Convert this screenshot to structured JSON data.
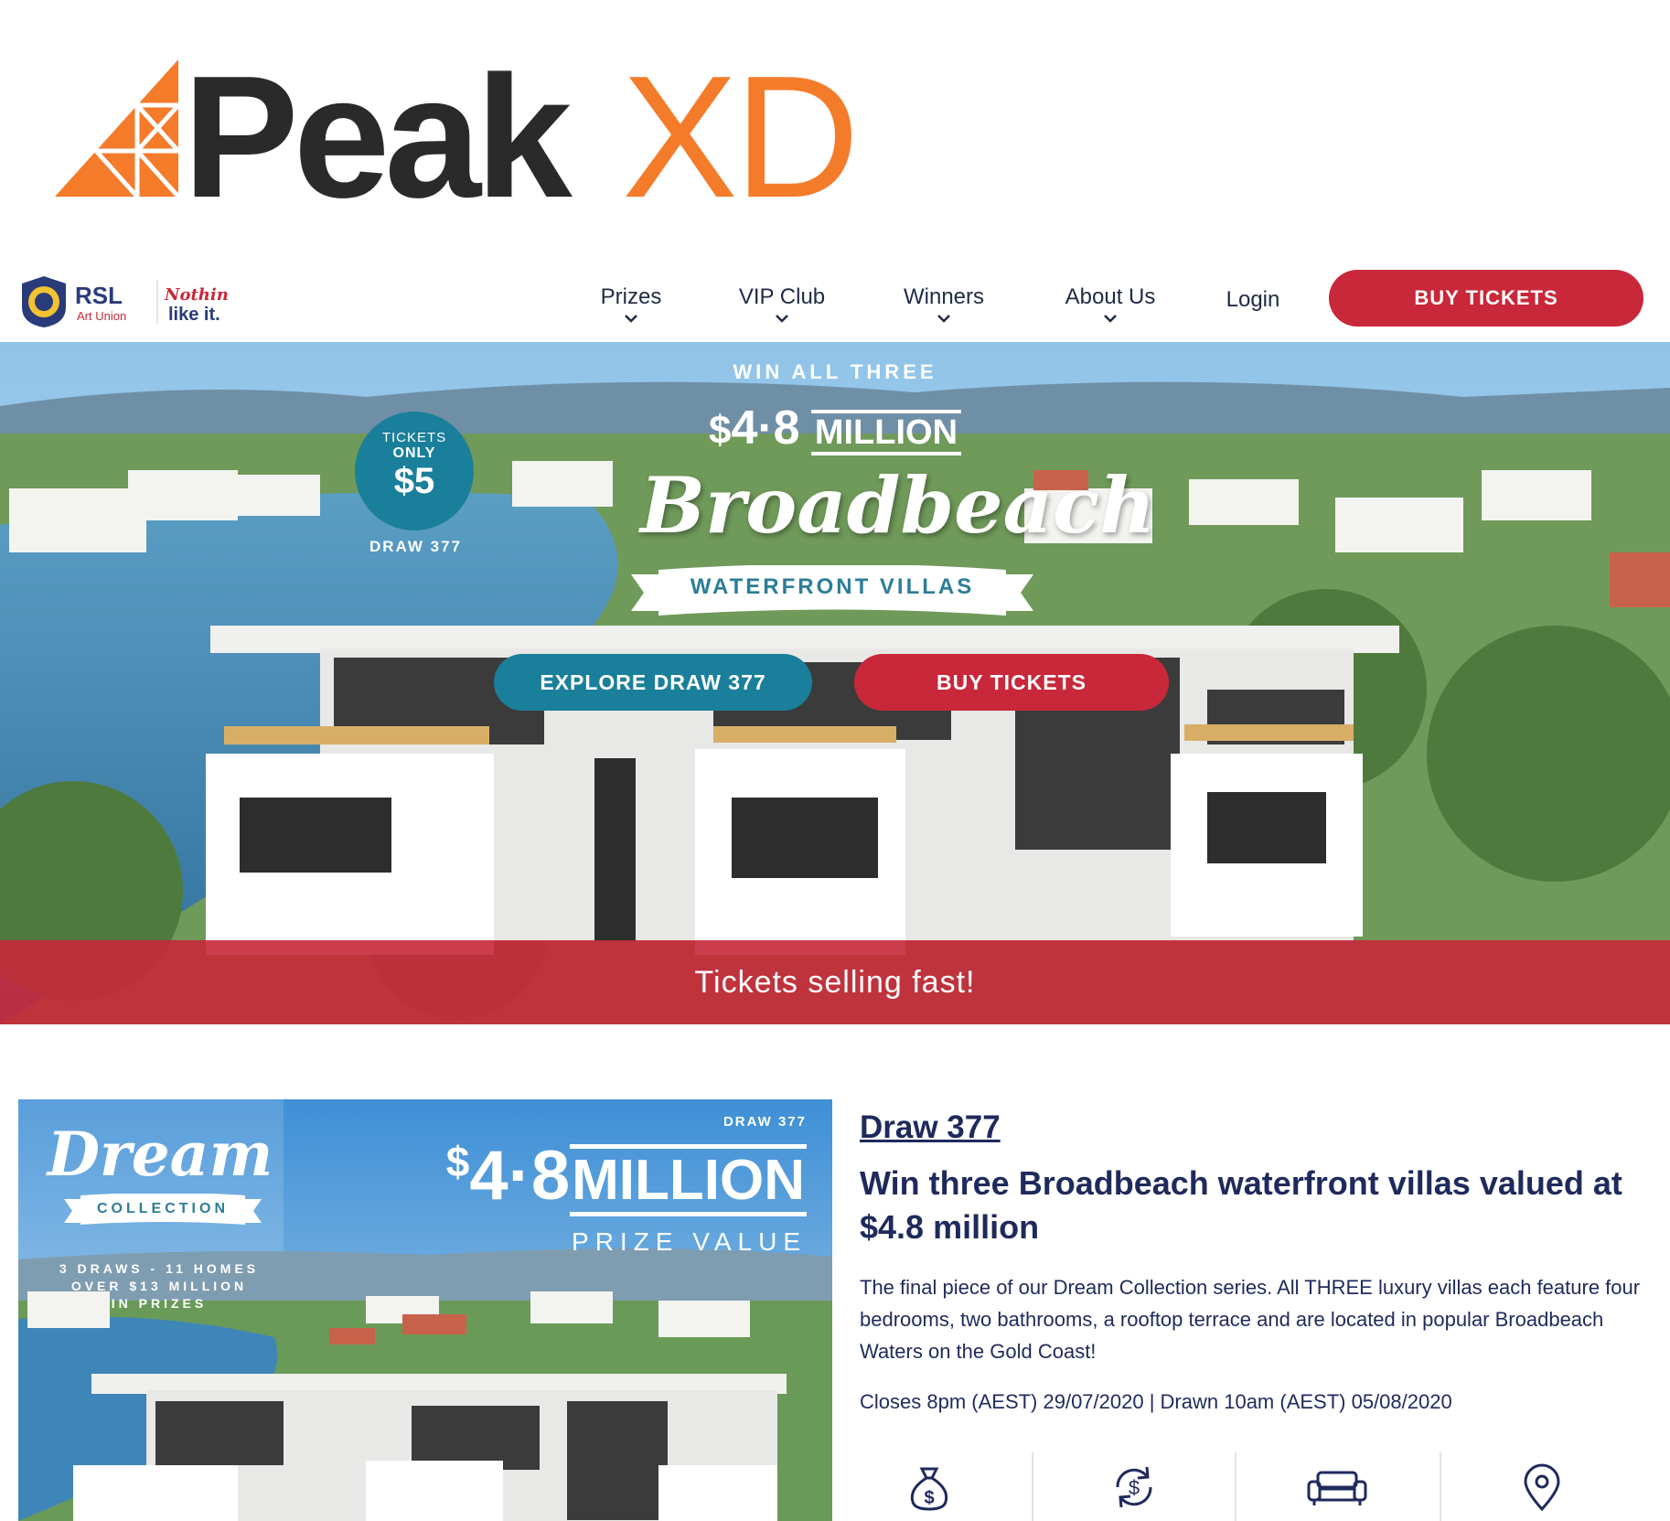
{
  "brand": {
    "peak": "Peak",
    "xd": "XD"
  },
  "colors": {
    "orange": "#f47b2a",
    "dark": "#2a2a2a",
    "red": "#c8283a",
    "teal": "#1a7f9a",
    "navy": "#1f2a5c"
  },
  "rsl": {
    "name": "RSL",
    "sub": "Art Union",
    "tagline_1": "Nothing",
    "tagline_2": "like it."
  },
  "nav": {
    "items": [
      {
        "label": "Prizes",
        "has_dropdown": true
      },
      {
        "label": "VIP Club",
        "has_dropdown": true
      },
      {
        "label": "Winners",
        "has_dropdown": true
      },
      {
        "label": "About Us",
        "has_dropdown": true
      },
      {
        "label": "Login",
        "has_dropdown": false
      }
    ],
    "buy_label": "BUY TICKETS"
  },
  "hero": {
    "badge_line1": "TICKETS",
    "badge_line2": "ONLY",
    "badge_price": "$5",
    "badge_draw": "DRAW 377",
    "win_all": "WIN ALL THREE",
    "amount_dollar": "$",
    "amount_number": "4·8",
    "amount_million": "MILLION",
    "script_title": "Broadbeach",
    "ribbon_text": "WATERFRONT VILLAS",
    "explore_label": "EXPLORE DRAW 377",
    "buy_label": "BUY TICKETS",
    "banner_text": "Tickets selling fast!"
  },
  "promo": {
    "dream": "Dream",
    "collection": "COLLECTION",
    "sub_1": "3 DRAWS - 11 HOMES",
    "sub_2": "OVER $13 MILLION",
    "sub_3": "IN PRIZES",
    "draw": "DRAW 377",
    "amount_dollar": "$",
    "amount_number": "4·8",
    "amount_million": "MILLION",
    "prize_value": "PRIZE VALUE"
  },
  "draw": {
    "title": "Draw 377",
    "headline": "Win three Broadbeach waterfront villas valued at $4.8 million",
    "description": "The final piece of our Dream Collection series. All THREE luxury villas each feature four bedrooms, two bathrooms, a rooftop terrace and are located in popular Broadbeach Waters on the Gold Coast!",
    "dates": "Closes 8pm (AEST) 29/07/2020 | Drawn 10am (AEST) 05/08/2020"
  },
  "features": {
    "icons": [
      "money-bag-icon",
      "cash-cycle-icon",
      "sofa-icon",
      "location-pin-icon"
    ]
  }
}
